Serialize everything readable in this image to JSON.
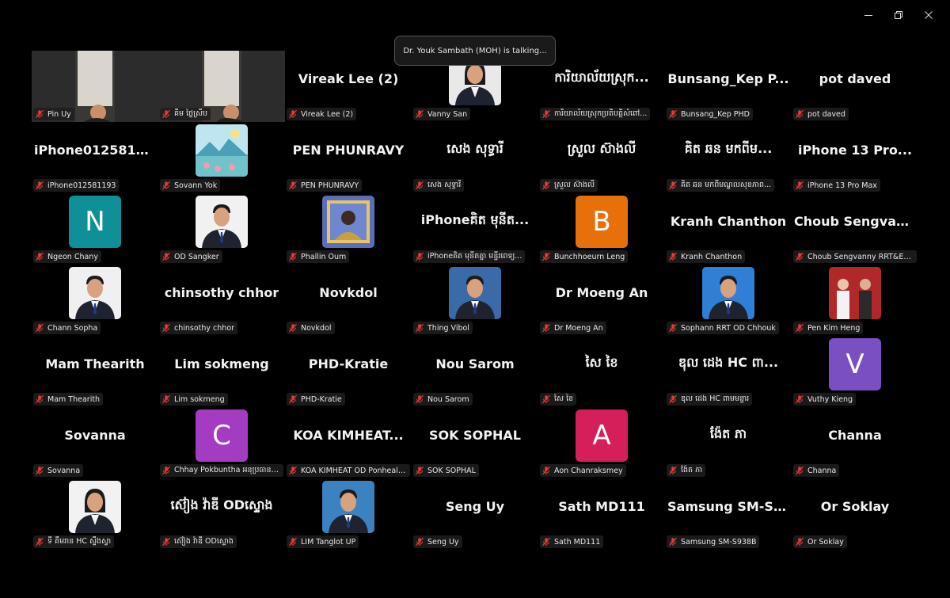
{
  "window_controls": {
    "minimize": "—",
    "restore": "❐",
    "close": "✕"
  },
  "talking_indicator": "Dr. Youk Sambath (MOH) is talking...",
  "participants": [
    {
      "display": "",
      "label": "Pin Uy",
      "kind": "video",
      "bg": "#3a3835"
    },
    {
      "display": "",
      "label": "គឹម ថ្លៃស្រីប",
      "kind": "video",
      "bg": "#3f3b37"
    },
    {
      "display": "Vireak Lee (2)",
      "label": "Vireak Lee (2)",
      "kind": "name"
    },
    {
      "display": "",
      "label": "Vanny San",
      "kind": "photo",
      "bg": "#e9e9e9",
      "icon": "person-photo-woman"
    },
    {
      "display": "ការិយាល័យស្រុក...",
      "label": "ការិយាល័យស្រុកប្រតិបត្តិសំពៅ...",
      "kind": "name"
    },
    {
      "display": "Bunsang_Kep  P...",
      "label": "Bunsang_Kep PHD",
      "kind": "name"
    },
    {
      "display": "pot daved",
      "label": "pot daved",
      "kind": "name"
    },
    {
      "display": "iPhone012581193",
      "label": "iPhone012581193",
      "kind": "name"
    },
    {
      "display": "",
      "label": "Sovann Yok",
      "kind": "photo",
      "bg": "#8fd1d9",
      "icon": "landscape-picture"
    },
    {
      "display": "PEN PHUNRAVY",
      "label": "PEN PHUNRAVY",
      "kind": "name"
    },
    {
      "display": "សេង សុទ្ធារី",
      "label": "សេង សុទ្ធារី",
      "kind": "name"
    },
    {
      "display": "ស្រួល ស៊ាងលី",
      "label": "ស្រួល ស៊ាងលី",
      "kind": "name"
    },
    {
      "display": "គិត ឆន មកពីម...",
      "label": "គិត ឆន មកពីមណ្ឌលសុខភាព...",
      "kind": "name"
    },
    {
      "display": "iPhone 13 Pro...",
      "label": "iPhone 13 Pro Max",
      "kind": "name"
    },
    {
      "display": "N",
      "label": "Ngeon Chany",
      "kind": "avatar",
      "bg": "#0f8f98"
    },
    {
      "display": "",
      "label": "OD Sangker",
      "kind": "photo",
      "bg": "#f1f1f1",
      "icon": "person-photo-man"
    },
    {
      "display": "",
      "label": "Phallin Oum",
      "kind": "photo",
      "bg": "#5a6fb8",
      "icon": "person-photo-framed"
    },
    {
      "display": "iPhoneគិត មុនីត...",
      "label": "iPhoneគិត មុនីតគ្នា មន្ទីរពេទ្យ...",
      "kind": "name"
    },
    {
      "display": "B",
      "label": "Bunchhoeurn Leng",
      "kind": "avatar",
      "bg": "#e8700a"
    },
    {
      "display": "Kranh Chanthon",
      "label": "Kranh Chanthon",
      "kind": "name"
    },
    {
      "display": "Choub  Sengvan...",
      "label": "Choub Sengvanny RRT&EPI O...",
      "kind": "name"
    },
    {
      "display": "",
      "label": "Chann Sopha",
      "kind": "photo",
      "bg": "#f0f0f0",
      "icon": "person-photo-man"
    },
    {
      "display": "chinsothy chhor",
      "label": "chinsothy chhor",
      "kind": "name"
    },
    {
      "display": "Novkdol",
      "label": "Novkdol",
      "kind": "name"
    },
    {
      "display": "",
      "label": "Thing Vibol",
      "kind": "photo",
      "bg": "#3a6aa8",
      "icon": "person-photo-man"
    },
    {
      "display": "Dr Moeng An",
      "label": "Dr Moeng An",
      "kind": "name"
    },
    {
      "display": "",
      "label": "Sophann RRT OD Chhouk",
      "kind": "photo",
      "bg": "#2f7fd6",
      "icon": "person-photo-man"
    },
    {
      "display": "",
      "label": "Pen Kim Heng",
      "kind": "photo",
      "bg": "#b02828",
      "icon": "group-photo"
    },
    {
      "display": "Mam Thearith",
      "label": "Mam Thearith",
      "kind": "name"
    },
    {
      "display": "Lim sokmeng",
      "label": "Lim sokmeng",
      "kind": "name"
    },
    {
      "display": "PHD-Kratie",
      "label": "PHD-Kratie",
      "kind": "name"
    },
    {
      "display": "Nou Sarom",
      "label": "Nou Sarom",
      "kind": "name"
    },
    {
      "display": "សៃ ខៃ",
      "label": "សៃ ខៃ",
      "kind": "name"
    },
    {
      "display": "ឌុល ដេង HC ពា...",
      "label": "ឌុល ដេង HC ពាមមន្ទារ",
      "kind": "name"
    },
    {
      "display": "V",
      "label": "Vuthy Kieng",
      "kind": "avatar",
      "bg": "#7a4fc2"
    },
    {
      "display": "Sovanna",
      "label": "Sovanna",
      "kind": "name"
    },
    {
      "display": "C",
      "label": "Chhay Pokbuntha អនុប្រធាន ...",
      "kind": "avatar",
      "bg": "#a33cc0"
    },
    {
      "display": "KOA  KIMHEAT...",
      "label": "KOA KIMHEAT OD Ponhealeu",
      "kind": "name"
    },
    {
      "display": "SOK SOPHAL",
      "label": "SOK SOPHAL",
      "kind": "name"
    },
    {
      "display": "A",
      "label": "Aon Chanraksmey",
      "kind": "avatar",
      "bg": "#d41f5a"
    },
    {
      "display": "ង៉ែត ភា",
      "label": "ង៉ែត ភា",
      "kind": "name"
    },
    {
      "display": "Channa",
      "label": "Channa",
      "kind": "name"
    },
    {
      "display": "",
      "label": "ទី គឹមរាន HC ស្ទឹងស្វា",
      "kind": "photo",
      "bg": "#f2f2f2",
      "icon": "person-photo-woman"
    },
    {
      "display": "ស៊ៀង វ៉ាឌី ODស្ទោង",
      "label": "ស៊ៀង វ៉ាឌី ODស្ទោង",
      "kind": "name"
    },
    {
      "display": "",
      "label": "LIM Tanglot UP",
      "kind": "photo",
      "bg": "#3c82c0",
      "icon": "person-photo-man"
    },
    {
      "display": "Seng Uy",
      "label": "Seng Uy",
      "kind": "name"
    },
    {
      "display": "Sath MD111",
      "label": "Sath MD111",
      "kind": "name"
    },
    {
      "display": "Samsung  SM-S9...",
      "label": "Samsung SM-S938B",
      "kind": "name"
    },
    {
      "display": "Or Soklay",
      "label": "Or Soklay",
      "kind": "name"
    }
  ]
}
